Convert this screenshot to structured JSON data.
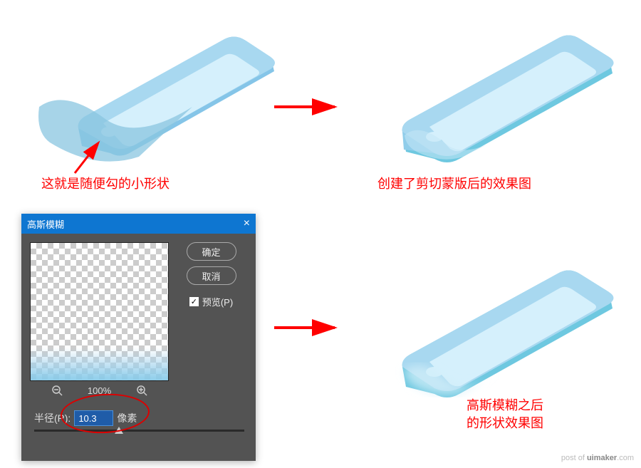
{
  "captions": {
    "top_left": "这就是随便勾的小形状",
    "top_right": "创建了剪切蒙版后的效果图",
    "bottom_right_line1": "高斯模糊之后",
    "bottom_right_line2": "的形状效果图"
  },
  "dialog": {
    "title": "高斯模糊",
    "ok": "确定",
    "cancel": "取消",
    "preview_label": "预览(P)",
    "preview_checked": "✓",
    "zoom_percent": "100%",
    "radius_label": "半径(R):",
    "radius_value": "10.3",
    "radius_unit": "像素"
  },
  "watermark": {
    "prefix": "post of ",
    "brand": "uimaker",
    "suffix": ".com"
  }
}
